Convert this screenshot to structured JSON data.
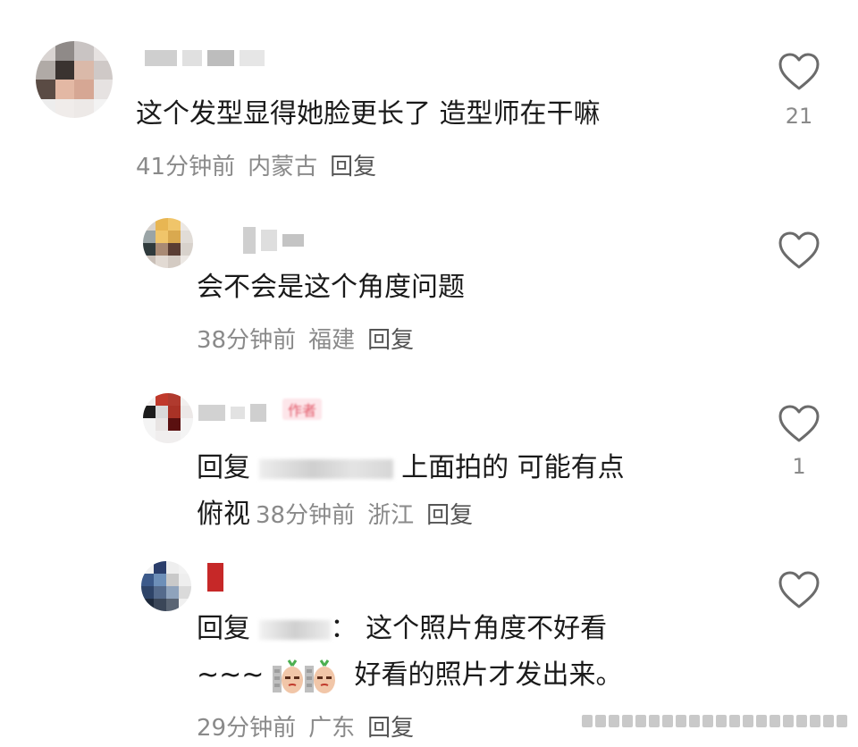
{
  "comments": [
    {
      "text": "这个发型显得她脸更长了 造型师在干嘛",
      "time": "41分钟前",
      "location": "内蒙古",
      "reply_label": "回复",
      "likes": "21"
    },
    {
      "text": "会不会是这个角度问题",
      "time": "38分钟前",
      "location": "福建",
      "reply_label": "回复",
      "likes": ""
    },
    {
      "reply_prefix": "回复",
      "text_after": "上面拍的 可能有点",
      "text_line2": "俯视",
      "time": "38分钟前",
      "location": "浙江",
      "reply_label": "回复",
      "likes": "1",
      "badge": "作者"
    },
    {
      "reply_prefix": "回复",
      "text_after": "这个照片角度不好看",
      "line2_prefix": "~~~",
      "line2_text": "好看的照片才发出来。",
      "time": "29分钟前",
      "location": "广东",
      "reply_label": "回复",
      "likes": ""
    }
  ],
  "colors": {
    "text": "#1a1a1a",
    "meta": "#8a8a8a",
    "reply": "#555555",
    "heart": "#6b6b6b"
  },
  "icons": [
    "heart-outline-icon",
    "sticker-icon"
  ]
}
